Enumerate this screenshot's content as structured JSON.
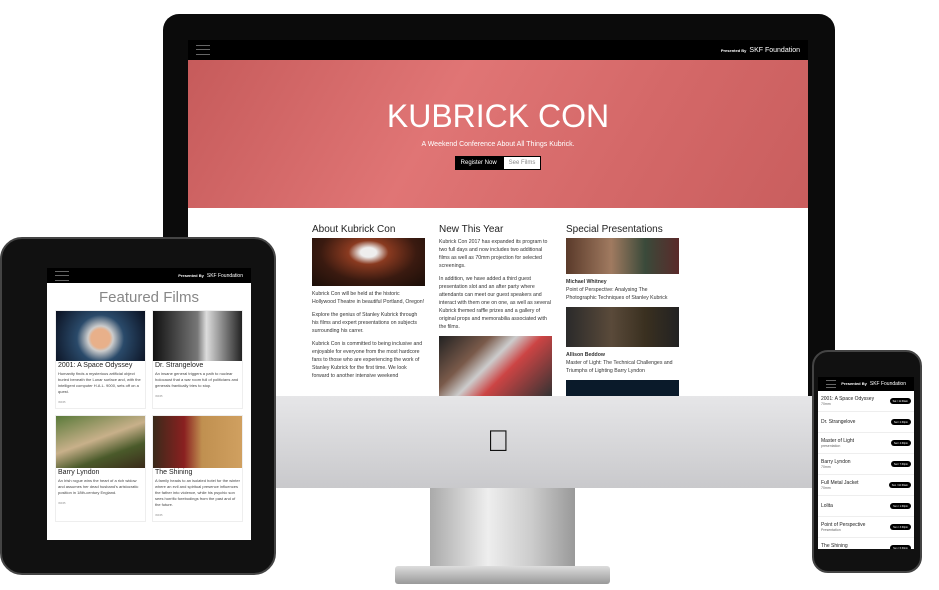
{
  "desktop": {
    "brand_prefix": "Presented By",
    "brand": "SKF Foundation",
    "hero": {
      "title": "KUBRICK CON",
      "subtitle": "A Weekend Conference About All Things Kubrick.",
      "register": "Register Now",
      "see_films": "See Films"
    },
    "about": {
      "heading": "About Kubrick Con",
      "p1": "Kubrick Con will be held at the historic Hollywood Theatre in beautiful Portland, Oregon!",
      "p2": "Explore the genius of Stanley Kubrick through his films and expert presentations on subjects surrounding his carrer.",
      "p3": "Kubrick Con is committed to being inclusive and enjoyable for everyone from the most hardcore fans to those who are experiencing the work of Stanley Kubrick for the first time. We look forward to another intensive weekend"
    },
    "new": {
      "heading": "New This Year",
      "p1": "Kubrick Con 2017 has expanded its program to two full days and now includes two additional films as well as 70mm projection for selected screenings.",
      "p2": "In addition, we have added a third guest presentation slot and an after party where attendants can meet our guest speakers and interact with them one on one, as well as several Kubrick themed raffle prizes and a gallery of original props and memorabilia associated with the films."
    },
    "special": {
      "heading": "Special Presentations",
      "items": [
        {
          "name": "Michael Whitney",
          "title": "Point of Perspective: Analysing The Photographic Techniques of Stanley Kubrick"
        },
        {
          "name": "Allison Beddow",
          "title": "Master of Light: The Technical Challenges and Triumphs of Lighting Barry Lyndon"
        }
      ]
    }
  },
  "tablet": {
    "brand_prefix": "Presented By",
    "brand": "SKF Foundation",
    "title": "Featured Films",
    "more": "IMDB",
    "films": [
      {
        "title": "2001: A Space Odyssey",
        "desc": "Humanity finds a mysterious artificial object buried beneath the Lunar surface and, with the intelligent computer H.A.L. 9000, sets off on a quest."
      },
      {
        "title": "Dr. Strangelove",
        "desc": "An insane general triggers a path to nuclear holocaust that a war room full of politicians and generals frantically tries to stop."
      },
      {
        "title": "Barry Lyndon",
        "desc": "An Irish rogue wins the heart of a rich widow and assumes her dead husband's aristocratic position in 18th-century England."
      },
      {
        "title": "The Shining",
        "desc": "A family heads to an isolated hotel for the winter where an evil and spiritual presence influences the father into violence, while his psychic son sees horrific forebodings from the past and of the future."
      }
    ]
  },
  "phone": {
    "brand_prefix": "Presented By",
    "brand": "SKF Foundation",
    "schedule": [
      {
        "title": "2001: A Space Odyssey",
        "sub": "70mm",
        "time": "Sat / 11:30am"
      },
      {
        "title": "Dr. Strangelove",
        "sub": "",
        "time": "Sat / 2:30pm"
      },
      {
        "title": "Master of Light",
        "sub": "presentation",
        "time": "Sat / 4:30pm"
      },
      {
        "title": "Barry Lyndon",
        "sub": "70mm",
        "time": "Sat / 7:30pm"
      },
      {
        "title": "Full Metal Jacket",
        "sub": "70mm",
        "time": "Sun / 10:30am"
      },
      {
        "title": "Lolita",
        "sub": "",
        "time": "Sun / 1:30pm"
      },
      {
        "title": "Point of Perspective",
        "sub": "Presentation",
        "time": "Sun / 3:30pm"
      },
      {
        "title": "The Shining",
        "sub": "70mm",
        "time": "Sun / 6:30pm"
      }
    ]
  }
}
